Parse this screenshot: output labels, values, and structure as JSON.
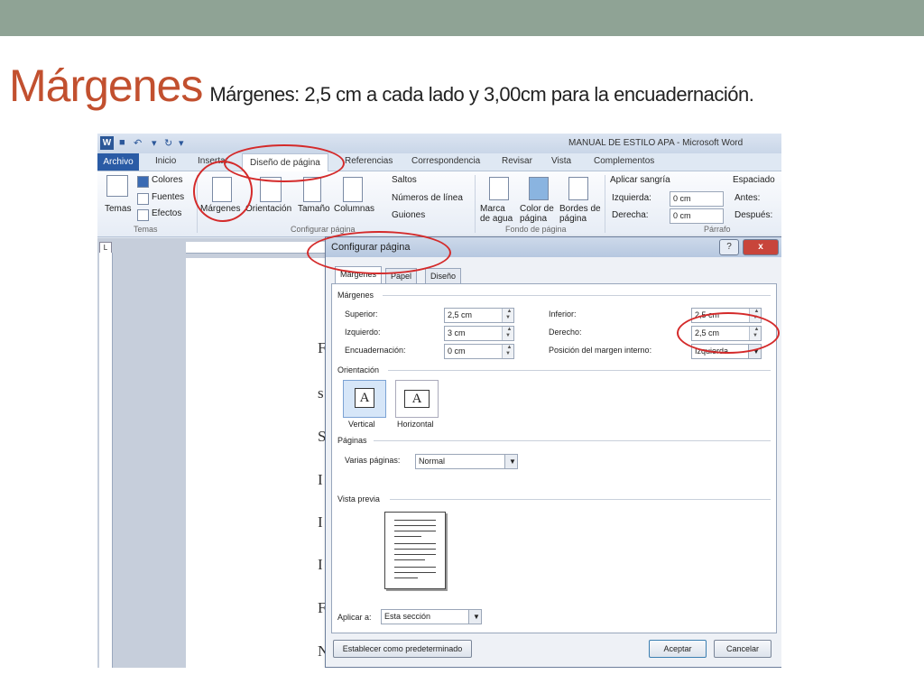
{
  "slide": {
    "title": "Márgenes",
    "subtitle": "Márgenes: 2,5 cm a cada lado y 3,00cm para la encuadernación."
  },
  "word": {
    "window_title": "MANUAL DE ESTILO APA  -  Microsoft Word",
    "tabs": [
      "Archivo",
      "Inicio",
      "Insertar",
      "Diseño de página",
      "Referencias",
      "Correspondencia",
      "Revisar",
      "Vista",
      "Complementos"
    ],
    "ribbon": {
      "temas": "Temas",
      "colores": "Colores",
      "fuentes": "Fuentes",
      "efectos": "Efectos",
      "margenes": "Márgenes",
      "orientacion": "Orientación",
      "tamano": "Tamaño",
      "columnas": "Columnas",
      "saltos": "Saltos",
      "numeros_linea": "Números de línea",
      "guiones": "Guiones",
      "marca_agua": "Marca de agua",
      "color_pagina": "Color de página",
      "bordes_pagina": "Bordes de página",
      "aplicar_sangria": "Aplicar sangría",
      "izquierda": "Izquierda:",
      "izquierda_val": "0 cm",
      "derecha": "Derecha:",
      "derecha_val": "0 cm",
      "espaciado": "Espaciado",
      "antes": "Antes:",
      "despues": "Después:",
      "grp_temas": "Temas",
      "grp_config": "Configurar página",
      "grp_fondo": "Fondo de página",
      "grp_parrafo": "Párrafo"
    },
    "page_letters": [
      "F",
      "s",
      "S",
      "I",
      "I",
      "I",
      "F",
      "N"
    ]
  },
  "dialog": {
    "title": "Configurar página",
    "help": "?",
    "close": "x",
    "tabs": [
      "Márgenes",
      "Papel",
      "Diseño"
    ],
    "margenes_section": "Márgenes",
    "superior_label": "Superior:",
    "superior_val": "2,5 cm",
    "inferior_label": "Inferior:",
    "inferior_val": "2,5 cm",
    "izquierdo_label": "Izquierdo:",
    "izquierdo_val": "3 cm",
    "derecho_label": "Derecho:",
    "derecho_val": "2,5 cm",
    "encuad_label": "Encuadernación:",
    "encuad_val": "0 cm",
    "posicion_label": "Posición del margen interno:",
    "posicion_val": "Izquierda",
    "orientacion_section": "Orientación",
    "vertical": "Vertical",
    "horizontal": "Horizontal",
    "paginas_section": "Páginas",
    "varias_label": "Varias páginas:",
    "varias_val": "Normal",
    "vista_section": "Vista previa",
    "aplicar_label": "Aplicar a:",
    "aplicar_val": "Esta sección",
    "default_btn": "Establecer como predeterminado",
    "ok_btn": "Aceptar",
    "cancel_btn": "Cancelar"
  }
}
